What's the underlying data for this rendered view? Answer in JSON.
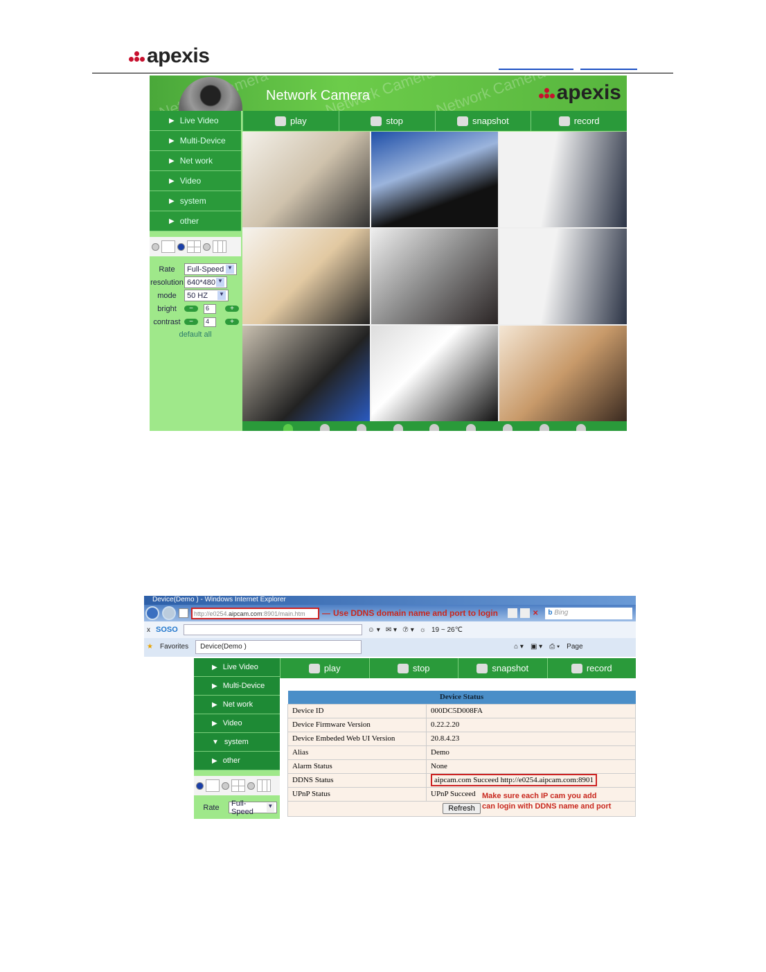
{
  "doc": {
    "logo": "apexis"
  },
  "cam1": {
    "header_title": "Network Camera",
    "watermark": "Network Camera",
    "brand": "apexis",
    "toolbar": [
      {
        "label": "play",
        "icon": "play-icon"
      },
      {
        "label": "stop",
        "icon": "stop-icon"
      },
      {
        "label": "snapshot",
        "icon": "camera-icon"
      },
      {
        "label": "record",
        "icon": "record-icon"
      }
    ],
    "nav": [
      "Live Video",
      "Multi-Device",
      "Net work",
      "Video",
      "system",
      "other"
    ],
    "controls": {
      "rate_label": "Rate",
      "rate": "Full-Speed",
      "resolution_label": "resolution",
      "resolution": "640*480",
      "mode_label": "mode",
      "mode": "50 HZ",
      "bright_label": "bright",
      "bright": "6",
      "contrast_label": "contrast",
      "contrast": "4",
      "default_all": "default all"
    },
    "selected_layout": "9-view",
    "active_channel": 1
  },
  "ie": {
    "title": "Device(Demo ) - Windows Internet Explorer",
    "url_prefix": "http://e0254.",
    "url_domain": "aipcam.com",
    "url_suffix": ":8901/main.htm",
    "annotation": "Use DDNS domain name and port to login",
    "search_placeholder": "Bing",
    "toolbar_brand": "SOSO",
    "weather": "19 ~ 26℃",
    "favorites": "Favorites",
    "tab": "Device(Demo )",
    "page_menu": "Page"
  },
  "cam2": {
    "toolbar": [
      {
        "label": "play"
      },
      {
        "label": "stop"
      },
      {
        "label": "snapshot"
      },
      {
        "label": "record"
      }
    ],
    "nav": [
      {
        "label": "Live Video",
        "expanded": false
      },
      {
        "label": "Multi-Device",
        "expanded": false
      },
      {
        "label": "Net work",
        "expanded": false
      },
      {
        "label": "Video",
        "expanded": false
      },
      {
        "label": "system",
        "expanded": true
      },
      {
        "label": "other",
        "expanded": false
      }
    ],
    "rate_label": "Rate",
    "rate": "Full-Speed",
    "selected_layout": "1-view",
    "status": {
      "title": "Device Status",
      "rows": [
        [
          "Device ID",
          "000DC5D008FA"
        ],
        [
          "Device Firmware Version",
          "0.22.2.20"
        ],
        [
          "Device Embeded Web UI Version",
          "20.8.4.23"
        ],
        [
          "Alias",
          "Demo"
        ],
        [
          "Alarm Status",
          "None"
        ],
        [
          "DDNS Status",
          "aipcam.com  Succeed  http://e0254.aipcam.com:8901"
        ],
        [
          "UPnP Status",
          "UPnP Succeed"
        ]
      ],
      "refresh": "Refresh",
      "annotation_line1": "Make sure each IP cam you add",
      "annotation_line2": "can login with DDNS name and port"
    }
  },
  "colors": {
    "green": "#2a9a3a",
    "light_green": "#9fe88a",
    "annotation_red": "#c8281e",
    "header_blue": "#4a8ec8"
  }
}
